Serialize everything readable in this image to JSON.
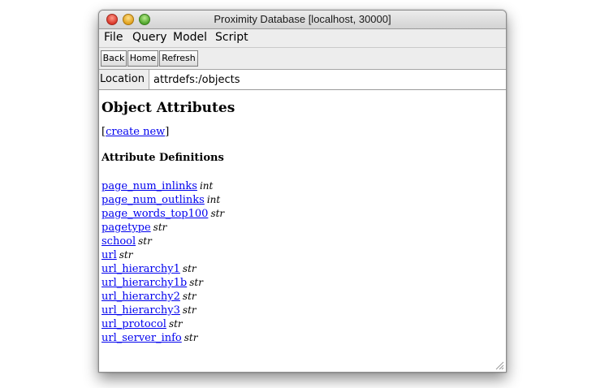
{
  "window": {
    "title": "Proximity Database [localhost, 30000]"
  },
  "menubar": {
    "items": [
      "File",
      "Query",
      "Model",
      "Script"
    ]
  },
  "toolbar": {
    "back_label": "Back",
    "home_label": "Home",
    "refresh_label": "Refresh"
  },
  "location": {
    "label": "Location",
    "value": "attrdefs:/objects"
  },
  "page": {
    "heading": "Object Attributes",
    "create_open": "[",
    "create_label": "create new",
    "create_close": "]",
    "section_heading": "Attribute Definitions",
    "attributes": [
      {
        "name": "page_num_inlinks",
        "type": "int"
      },
      {
        "name": "page_num_outlinks",
        "type": "int"
      },
      {
        "name": "page_words_top100",
        "type": "str"
      },
      {
        "name": "pagetype",
        "type": "str"
      },
      {
        "name": "school",
        "type": "str"
      },
      {
        "name": "url",
        "type": "str"
      },
      {
        "name": "url_hierarchy1",
        "type": "str"
      },
      {
        "name": "url_hierarchy1b",
        "type": "str"
      },
      {
        "name": "url_hierarchy2",
        "type": "str"
      },
      {
        "name": "url_hierarchy3",
        "type": "str"
      },
      {
        "name": "url_protocol",
        "type": "str"
      },
      {
        "name": "url_server_info",
        "type": "str"
      }
    ]
  },
  "colors": {
    "link": "#0000ee",
    "chrome": "#ededed"
  },
  "icons": [
    "close-icon",
    "minimize-icon",
    "zoom-icon",
    "resize-grip-icon"
  ]
}
